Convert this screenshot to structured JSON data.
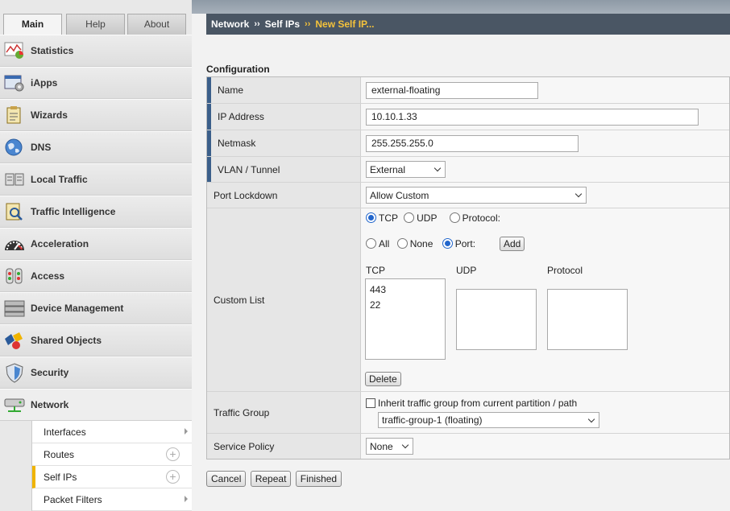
{
  "tabs": {
    "main": "Main",
    "help": "Help",
    "about": "About"
  },
  "menu": [
    {
      "label": "Statistics",
      "icon": "statistics-icon"
    },
    {
      "label": "iApps",
      "icon": "iapps-icon"
    },
    {
      "label": "Wizards",
      "icon": "wizards-icon"
    },
    {
      "label": "DNS",
      "icon": "dns-globe-icon"
    },
    {
      "label": "Local Traffic",
      "icon": "local-traffic-icon"
    },
    {
      "label": "Traffic Intelligence",
      "icon": "traffic-intelligence-icon"
    },
    {
      "label": "Acceleration",
      "icon": "acceleration-gauge-icon"
    },
    {
      "label": "Access",
      "icon": "access-icon"
    },
    {
      "label": "Device Management",
      "icon": "device-management-icon"
    },
    {
      "label": "Shared Objects",
      "icon": "shared-objects-icon"
    },
    {
      "label": "Security",
      "icon": "security-shield-icon"
    },
    {
      "label": "Network",
      "icon": "network-icon"
    }
  ],
  "submenu": [
    {
      "label": "Interfaces"
    },
    {
      "label": "Routes"
    },
    {
      "label": "Self IPs"
    },
    {
      "label": "Packet Filters"
    }
  ],
  "breadcrumb": {
    "network": "Network",
    "self_ips": "Self IPs",
    "current": "New Self IP...",
    "sep": "››"
  },
  "section_title": "Configuration",
  "form": {
    "name": {
      "label": "Name",
      "value": "external-floating"
    },
    "ip": {
      "label": "IP Address",
      "value": "10.10.1.33"
    },
    "netmask": {
      "label": "Netmask",
      "value": "255.255.255.0"
    },
    "vlan": {
      "label": "VLAN / Tunnel",
      "value": "External"
    },
    "port_lockdown": {
      "label": "Port Lockdown",
      "value": "Allow Custom"
    },
    "custom_list": {
      "label": "Custom List",
      "proto_tcp": "TCP",
      "proto_udp": "UDP",
      "proto_protocol": "Protocol:",
      "port_all": "All",
      "port_none": "None",
      "port_port": "Port:",
      "add": "Add",
      "col_tcp": "TCP",
      "col_udp": "UDP",
      "col_protocol": "Protocol",
      "tcp_items": [
        "443",
        "22"
      ],
      "delete": "Delete"
    },
    "traffic_group": {
      "label": "Traffic Group",
      "inherit_text": "Inherit traffic group from current partition / path",
      "value": "traffic-group-1 (floating)"
    },
    "service_policy": {
      "label": "Service Policy",
      "value": "None"
    }
  },
  "buttons": {
    "cancel": "Cancel",
    "repeat": "Repeat",
    "finished": "Finished"
  },
  "colors": {
    "breadcrumb_bg": "#4a5664",
    "breadcrumb_current": "#f5c33b",
    "required_bar": "#3b5f8a",
    "selected_radio": "#2266cc",
    "active_submenu_bar": "#f0b400"
  }
}
